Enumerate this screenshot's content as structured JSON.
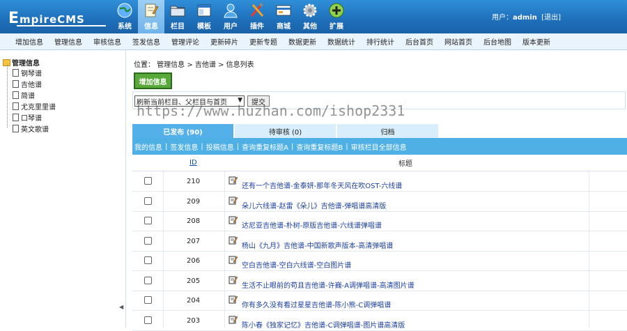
{
  "logo": {
    "first": "E",
    "rest": "mpireCMS"
  },
  "topnav": [
    {
      "label": "系统",
      "icon": "globe-icon"
    },
    {
      "label": "信息",
      "icon": "notepad-icon"
    },
    {
      "label": "栏目",
      "icon": "folder-icon"
    },
    {
      "label": "模板",
      "icon": "window-icon"
    },
    {
      "label": "用户",
      "icon": "user-icon"
    },
    {
      "label": "插件",
      "icon": "tools-icon"
    },
    {
      "label": "商城",
      "icon": "card-icon"
    },
    {
      "label": "其他",
      "icon": "gear-icon"
    },
    {
      "label": "扩展",
      "icon": "plus-icon"
    }
  ],
  "user": {
    "prefix": "用户：",
    "name": "admin",
    "logout": "[退出]"
  },
  "subnav": [
    "增加信息",
    "管理信息",
    "审核信息",
    "签发信息",
    "管理评论",
    "更新碎片",
    "更新专题",
    "数据更新",
    "数据统计",
    "排行统计",
    "后台首页",
    "网站首页",
    "后台地图",
    "版本更新"
  ],
  "tree": {
    "root": "管理信息",
    "items": [
      "钢琴谱",
      "吉他谱",
      "简谱",
      "尤克里里谱",
      "口琴谱",
      "英文歌谱"
    ]
  },
  "location": "位置： 管理信息 > 吉他谱 > 信息列表",
  "add_button": "增加信息",
  "refresh_select": "刷新当前栏目、父栏目与首页",
  "submit_button": "提交",
  "tabs": [
    "已发布 (90)",
    "待审核 (0)",
    "归档"
  ],
  "filters": [
    "我的信息",
    "签发信息",
    "投稿信息",
    "查询重复标题A",
    "查询重复标题B",
    "审核栏目全部信息"
  ],
  "table": {
    "header_id": "ID",
    "header_title": "标题",
    "rows": [
      {
        "id": "210",
        "title": "还有一个吉他谱-金泰妍-那年冬天风在吹OST-六线谱"
      },
      {
        "id": "209",
        "title": "朵儿六线谱-赵雷《朵儿》吉他谱-弹唱谱高清版"
      },
      {
        "id": "208",
        "title": "达尼亚吉他谱-朴树-原版吉他谱-六线谱弹唱谱"
      },
      {
        "id": "207",
        "title": "杨山《九月》吉他谱-中国新歌声版本-高清弹唱谱"
      },
      {
        "id": "206",
        "title": "空白吉他谱-空白六线谱-空白图片谱"
      },
      {
        "id": "205",
        "title": "生活不止眼前的苟且吉他谱-许巍-A调弹唱谱-高清图片谱"
      },
      {
        "id": "204",
        "title": "你有多久没有看过星星吉他谱-陈小熊-C调弹唱谱"
      },
      {
        "id": "203",
        "title": "陈小春《独家记忆》吉他谱-C调弹唱谱-图片谱高清版"
      }
    ]
  },
  "watermark": "https://www.huzhan.com/ishop2331",
  "collapse_arrow": "◀"
}
